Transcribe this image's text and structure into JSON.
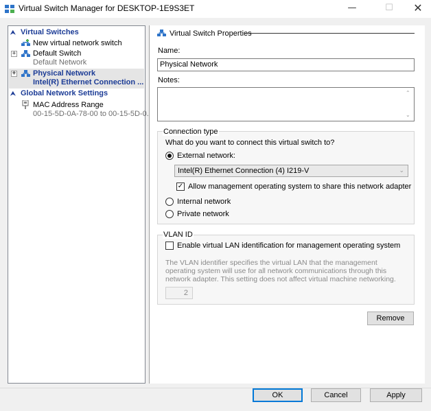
{
  "window": {
    "title": "Virtual Switch Manager for DESKTOP-1E9S3ET",
    "minimize_glyph": "—",
    "maximize_glyph": "☐",
    "close_glyph": "✕"
  },
  "tree": {
    "virtual_switches_header": "Virtual Switches",
    "new_switch": "New virtual network switch",
    "default_switch": {
      "name": "Default Switch",
      "sub": "Default Network"
    },
    "physical_network": {
      "name": "Physical Network",
      "sub": "Intel(R) Ethernet Connection ..."
    },
    "global_header": "Global Network Settings",
    "mac_range": {
      "name": "MAC Address Range",
      "sub": "00-15-5D-0A-78-00 to 00-15-5D-0..."
    }
  },
  "properties": {
    "section_title": "Virtual Switch Properties",
    "name_label": "Name:",
    "name_value": "Physical Network",
    "notes_label": "Notes:",
    "notes_value": "",
    "connection": {
      "title": "Connection type",
      "question": "What do you want to connect this virtual switch to?",
      "external_label": "External network:",
      "adapter_selected": "Intel(R) Ethernet Connection (4) I219-V",
      "allow_mgmt_label": "Allow management operating system to share this network adapter",
      "internal_label": "Internal network",
      "private_label": "Private network",
      "selected": "external",
      "allow_mgmt_checked": true
    },
    "vlan": {
      "title": "VLAN ID",
      "enable_label": "Enable virtual LAN identification for management operating system",
      "enable_checked": false,
      "description": "The VLAN identifier specifies the virtual LAN that the management operating system will use for all network communications through this network adapter. This setting does not affect virtual machine networking.",
      "id_value": "2"
    },
    "remove_button": "Remove"
  },
  "footer": {
    "ok": "OK",
    "cancel": "Cancel",
    "apply": "Apply"
  },
  "colors": {
    "accent": "#1c3c96",
    "focus": "#0078d7"
  }
}
